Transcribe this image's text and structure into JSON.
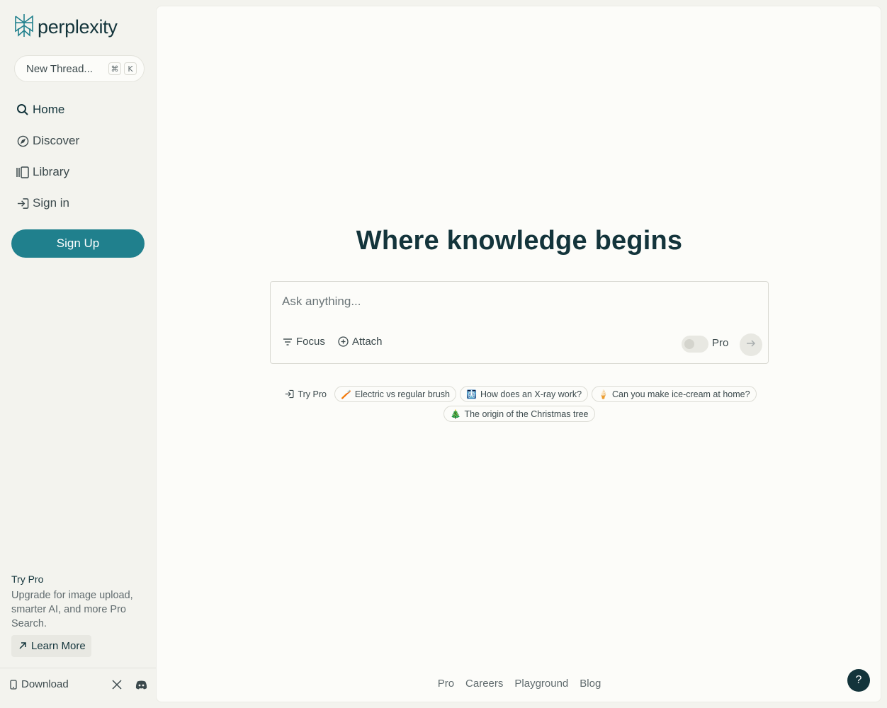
{
  "brand": {
    "name": "perplexity",
    "accent": "#20808d"
  },
  "sidebar": {
    "new_thread": {
      "label": "New Thread...",
      "shortcut_keys": [
        "⌘",
        "K"
      ]
    },
    "items": [
      {
        "label": "Home",
        "icon": "search-icon"
      },
      {
        "label": "Discover",
        "icon": "compass-icon"
      },
      {
        "label": "Library",
        "icon": "library-icon"
      },
      {
        "label": "Sign in",
        "icon": "sign-in-icon"
      }
    ],
    "signup_label": "Sign Up",
    "try_pro": {
      "title": "Try Pro",
      "description": "Upgrade for image upload, smarter AI, and more Pro Search.",
      "button_label": "Learn More"
    },
    "footer": {
      "download_label": "Download"
    }
  },
  "main": {
    "headline": "Where knowledge begins",
    "ask": {
      "placeholder": "Ask anything...",
      "focus_label": "Focus",
      "attach_label": "Attach",
      "pro_label": "Pro",
      "pro_enabled": false
    },
    "suggestions": [
      {
        "label": "Try Pro",
        "icon": "sign-in-icon"
      },
      {
        "label": "Electric vs regular brush",
        "icon": "🪥"
      },
      {
        "label": "How does an X-ray work?",
        "icon": "🩻"
      },
      {
        "label": "Can you make ice-cream at home?",
        "icon": "🍦"
      },
      {
        "label": "The origin of the Christmas tree",
        "icon": "🎄"
      }
    ],
    "footer_links": [
      "Pro",
      "Careers",
      "Playground",
      "Blog"
    ],
    "help_label": "?"
  }
}
